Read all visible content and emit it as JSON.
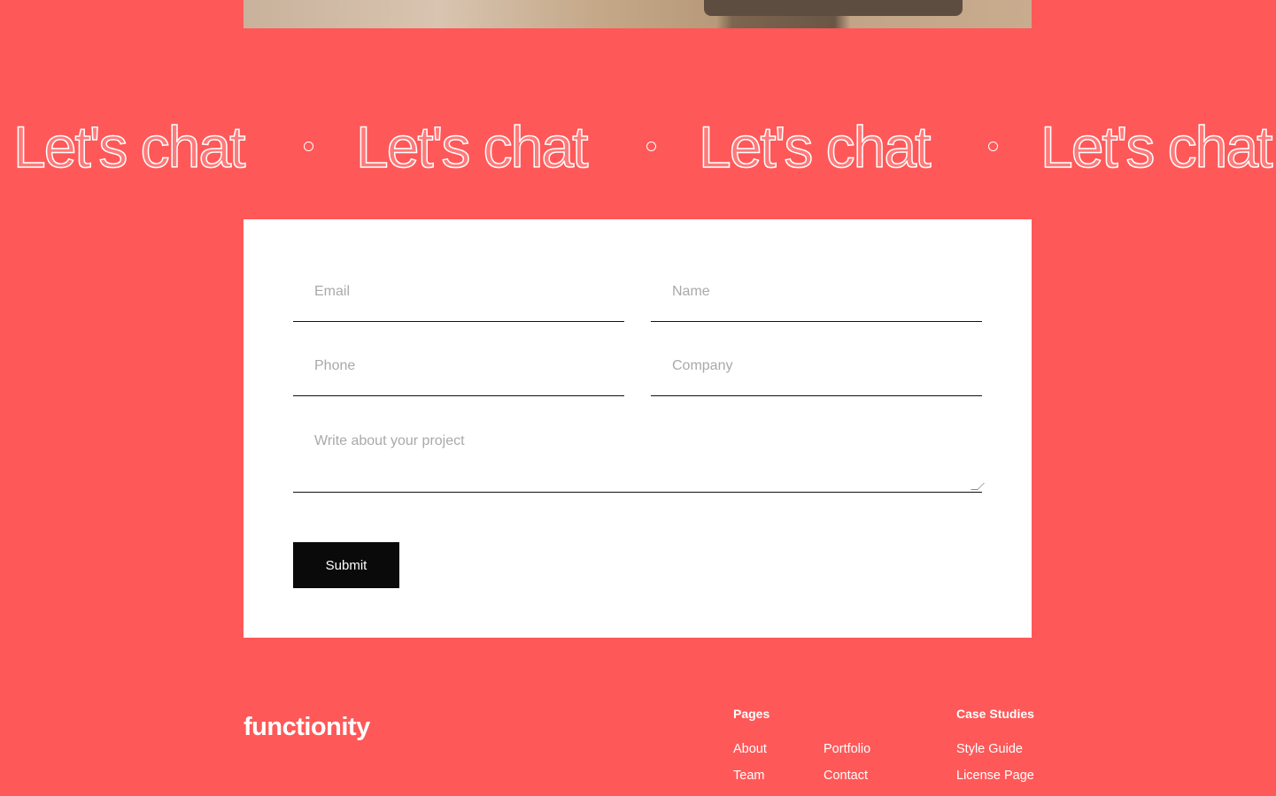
{
  "marquee": {
    "text": "Let's chat"
  },
  "form": {
    "email_placeholder": "Email",
    "name_placeholder": "Name",
    "phone_placeholder": "Phone",
    "company_placeholder": "Company",
    "message_placeholder": "Write about your project",
    "submit_label": "Submit"
  },
  "footer": {
    "logo": "functionity",
    "pages_heading": "Pages",
    "pages": [
      "About",
      "Team",
      "Portfolio",
      "Contact"
    ],
    "case_heading": "Case Studies",
    "case_links": [
      "Style Guide",
      "License Page"
    ]
  },
  "colors": {
    "background": "#ff5858",
    "card": "#ffffff",
    "button": "#0a0a0a"
  }
}
